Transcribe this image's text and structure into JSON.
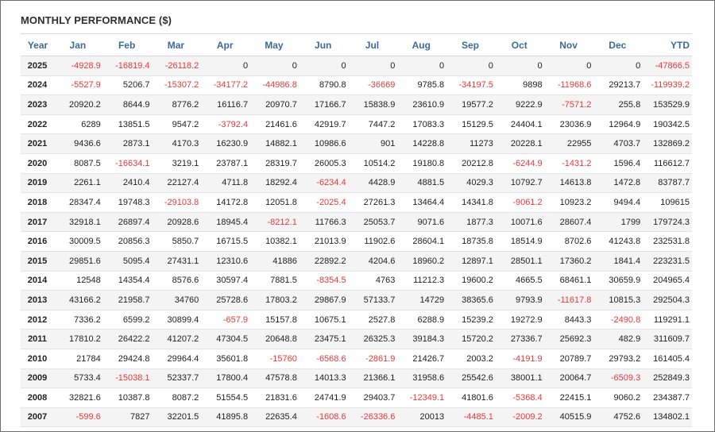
{
  "panel": {
    "title": "MONTHLY PERFORMANCE ($)"
  },
  "colors": {
    "negative": "#e8383a",
    "header": "#3d6a9b",
    "stripe": "#f4f4f4"
  },
  "table": {
    "headers": [
      "Year",
      "Jan",
      "Feb",
      "Mar",
      "Apr",
      "May",
      "Jun",
      "Jul",
      "Aug",
      "Sep",
      "Oct",
      "Nov",
      "Dec",
      "YTD"
    ],
    "rows": [
      [
        "2025",
        "-4928.9",
        "-16819.4",
        "-26118.2",
        "0",
        "0",
        "0",
        "0",
        "0",
        "0",
        "0",
        "0",
        "0",
        "-47866.5"
      ],
      [
        "2024",
        "-5527.9",
        "5206.7",
        "-15307.2",
        "-34177.2",
        "-44986.8",
        "8790.8",
        "-36669",
        "9785.8",
        "-34197.5",
        "9898",
        "-11968.6",
        "29213.7",
        "-119939.2"
      ],
      [
        "2023",
        "20920.2",
        "8644.9",
        "8776.2",
        "16116.7",
        "20970.7",
        "17166.7",
        "15838.9",
        "23610.9",
        "19577.2",
        "9222.9",
        "-7571.2",
        "255.8",
        "153529.9"
      ],
      [
        "2022",
        "6289",
        "13851.5",
        "9547.2",
        "-3792.4",
        "21461.6",
        "42919.7",
        "7447.2",
        "17083.3",
        "15129.5",
        "24404.1",
        "23036.9",
        "12964.9",
        "190342.5"
      ],
      [
        "2021",
        "9436.6",
        "2873.1",
        "4170.3",
        "16230.9",
        "14882.1",
        "10986.6",
        "901",
        "14228.8",
        "11273",
        "20228.1",
        "22955",
        "4703.7",
        "132869.2"
      ],
      [
        "2020",
        "8087.5",
        "-16634.1",
        "3219.1",
        "23787.1",
        "28319.7",
        "26005.3",
        "10514.2",
        "19180.8",
        "20212.8",
        "-6244.9",
        "-1431.2",
        "1596.4",
        "116612.7"
      ],
      [
        "2019",
        "2261.1",
        "2410.4",
        "22127.4",
        "4711.8",
        "18292.4",
        "-6234.4",
        "4428.9",
        "4881.5",
        "4029.3",
        "10792.7",
        "14613.8",
        "1472.8",
        "83787.7"
      ],
      [
        "2018",
        "28347.4",
        "19748.3",
        "-29103.8",
        "14172.8",
        "12051.8",
        "-2025.4",
        "27261.3",
        "13464.4",
        "14341.8",
        "-9061.2",
        "10923.2",
        "9494.4",
        "109615"
      ],
      [
        "2017",
        "32918.1",
        "26897.4",
        "20928.6",
        "18945.4",
        "-8212.1",
        "11766.3",
        "25053.7",
        "9071.6",
        "1877.3",
        "10071.6",
        "28607.4",
        "1799",
        "179724.3"
      ],
      [
        "2016",
        "30009.5",
        "20856.3",
        "5850.7",
        "16715.5",
        "10382.1",
        "21013.9",
        "11902.6",
        "28604.1",
        "18735.8",
        "18514.9",
        "8702.6",
        "41243.8",
        "232531.8"
      ],
      [
        "2015",
        "29851.6",
        "5095.4",
        "27431.1",
        "12310.6",
        "41886",
        "22892.2",
        "4204.6",
        "18960.2",
        "12897.1",
        "28501.1",
        "17360.2",
        "1841.4",
        "223231.5"
      ],
      [
        "2014",
        "12548",
        "14354.4",
        "8576.6",
        "30597.4",
        "7881.5",
        "-8354.5",
        "4763",
        "11212.3",
        "19600.2",
        "4665.5",
        "68461.1",
        "30659.9",
        "204965.4"
      ],
      [
        "2013",
        "43166.2",
        "21958.7",
        "34760",
        "25728.6",
        "17803.2",
        "29867.9",
        "57133.7",
        "14729",
        "38365.6",
        "9793.9",
        "-11617.8",
        "10815.3",
        "292504.3"
      ],
      [
        "2012",
        "7336.2",
        "6599.2",
        "30899.4",
        "-657.9",
        "15157.8",
        "10675.1",
        "2527.8",
        "6288.9",
        "15239.2",
        "19272.9",
        "8443.3",
        "-2490.8",
        "119291.1"
      ],
      [
        "2011",
        "17810.2",
        "26422.2",
        "41207.2",
        "47304.5",
        "20648.8",
        "23475.1",
        "26325.3",
        "39184.3",
        "15720.2",
        "27336.7",
        "25692.3",
        "482.9",
        "311609.7"
      ],
      [
        "2010",
        "21784",
        "29424.8",
        "29964.4",
        "35601.8",
        "-15760",
        "-6568.6",
        "-2861.9",
        "21426.7",
        "2003.2",
        "-4191.9",
        "20789.7",
        "29793.2",
        "161405.4"
      ],
      [
        "2009",
        "5733.4",
        "-15038.1",
        "52337.7",
        "17800.4",
        "47578.8",
        "14013.3",
        "21366.1",
        "31958.6",
        "25542.6",
        "38001.1",
        "20064.7",
        "-6509.3",
        "252849.3"
      ],
      [
        "2008",
        "32821.6",
        "10387.8",
        "8087.2",
        "51554.5",
        "21831.6",
        "24741.9",
        "29403.7",
        "-12349.1",
        "41801.6",
        "-5368.4",
        "22415.1",
        "9060.2",
        "234387.7"
      ],
      [
        "2007",
        "-599.6",
        "7827",
        "32201.5",
        "41895.8",
        "22635.4",
        "-1608.6",
        "-26336.6",
        "20013",
        "-4485.1",
        "-2009.2",
        "40515.9",
        "4752.6",
        "134802.1"
      ]
    ]
  }
}
